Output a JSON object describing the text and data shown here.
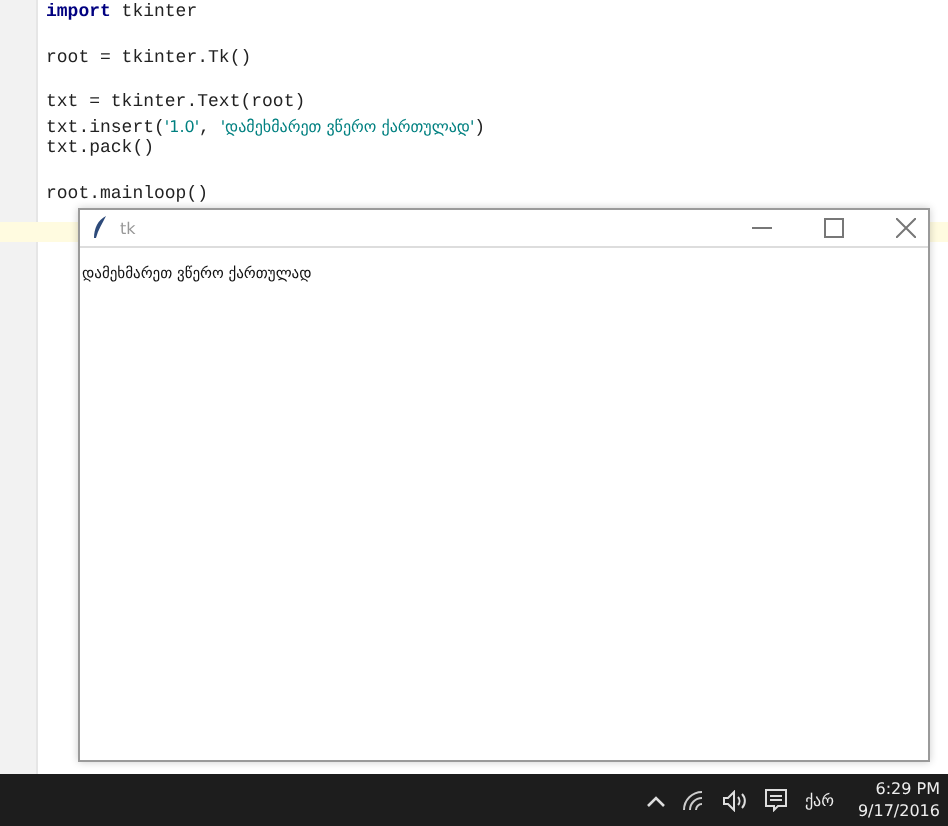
{
  "editor": {
    "blocks": [
      [
        [
          {
            "kind": "keyword",
            "text": "import"
          },
          {
            "kind": "plain",
            "text": " tkinter"
          }
        ]
      ],
      [
        [
          {
            "kind": "plain",
            "text": "root = tkinter.Tk()"
          }
        ]
      ],
      [
        [
          {
            "kind": "plain",
            "text": "txt = tkinter.Text(root)"
          }
        ],
        [
          {
            "kind": "plain",
            "text": "txt.insert("
          },
          {
            "kind": "string",
            "text": "'1.0'"
          },
          {
            "kind": "plain",
            "text": ", "
          },
          {
            "kind": "string",
            "text": "'დამეხმარეთ ვწერო ქართულად'"
          },
          {
            "kind": "plain",
            "text": ")"
          }
        ],
        [
          {
            "kind": "plain",
            "text": "txt.pack()"
          }
        ]
      ],
      [
        [
          {
            "kind": "plain",
            "text": "root.mainloop()"
          }
        ]
      ]
    ]
  },
  "tk_window": {
    "title": "tk",
    "text": "დამეხმარეთ ვწერო ქართულად"
  },
  "taskbar": {
    "language": "ქარ",
    "time": "6:29 PM",
    "date": "9/17/2016"
  }
}
